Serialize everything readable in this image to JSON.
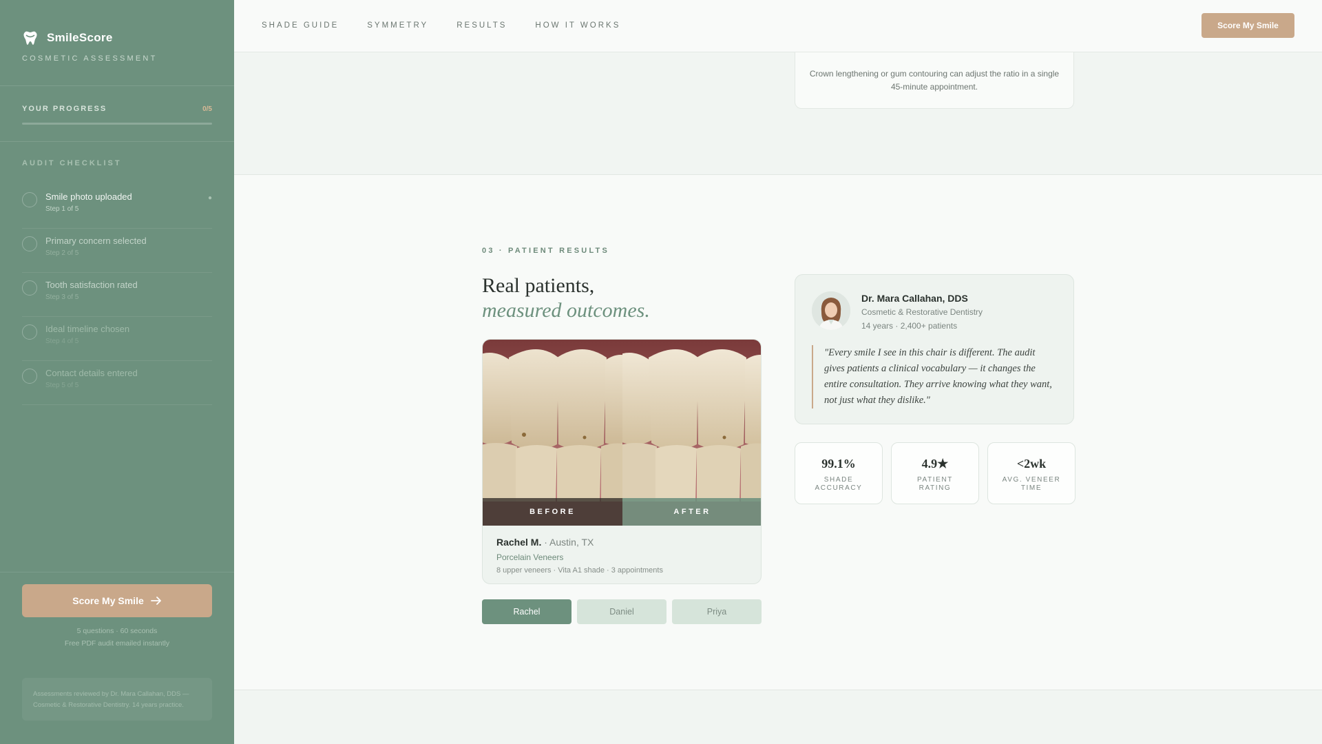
{
  "sidebar": {
    "brand_name": "SmileScore",
    "brand_subtitle": "COSMETIC ASSESSMENT",
    "progress": {
      "label": "YOUR PROGRESS",
      "count": "0/5",
      "fraction": 0
    },
    "checklist_label": "AUDIT CHECKLIST",
    "checklist": [
      {
        "title": "Smile photo uploaded",
        "step": "Step 1 of 5"
      },
      {
        "title": "Primary concern selected",
        "step": "Step 2 of 5"
      },
      {
        "title": "Tooth satisfaction rated",
        "step": "Step 3 of 5"
      },
      {
        "title": "Ideal timeline chosen",
        "step": "Step 4 of 5"
      },
      {
        "title": "Contact details entered",
        "step": "Step 5 of 5"
      }
    ],
    "cta_label": "Score My Smile",
    "note_line1": "5 questions · 60 seconds",
    "note_line2": "Free PDF audit emailed instantly",
    "disclaimer": "Assessments reviewed by Dr. Mara Callahan, DDS — Cosmetic & Restorative Dentistry. 14 years practice."
  },
  "nav": {
    "links": [
      "SHADE GUIDE",
      "SYMMETRY",
      "RESULTS",
      "HOW IT WORKS"
    ],
    "cta_label": "Score My Smile"
  },
  "upper_card_text": "Crown lengthening or gum contouring can adjust the ratio in a single 45-minute appointment.",
  "results": {
    "eyebrow": "03 · PATIENT RESULTS",
    "heading_line1": "Real patients,",
    "heading_line2": "measured outcomes.",
    "before_label": "BEFORE",
    "after_label": "AFTER",
    "patient": {
      "name": "Rachel M.",
      "location": "· Austin, TX",
      "treatment": "Porcelain Veneers",
      "details": "8 upper veneers · Vita A1 shade · 3 appointments"
    },
    "tabs": [
      "Rachel",
      "Daniel",
      "Priya"
    ],
    "active_tab": "Rachel",
    "doctor": {
      "name": "Dr. Mara Callahan, DDS",
      "specialty": "Cosmetic & Restorative Dentistry",
      "experience": "14 years · 2,400+ patients",
      "quote": "\"Every smile I see in this chair is different. The audit gives patients a clinical vocabulary — it changes the entire consultation. They arrive knowing what they want, not just what they dislike.\""
    },
    "stats": [
      {
        "value": "99.1%",
        "label": "SHADE ACCURACY"
      },
      {
        "value": "4.9★",
        "label": "PATIENT RATING"
      },
      {
        "value": "<2wk",
        "label": "AVG. VENEER TIME"
      }
    ]
  },
  "colors": {
    "sidebar": "#6d917e",
    "accent": "#c9a88a",
    "brand_green": "#6d917e"
  }
}
